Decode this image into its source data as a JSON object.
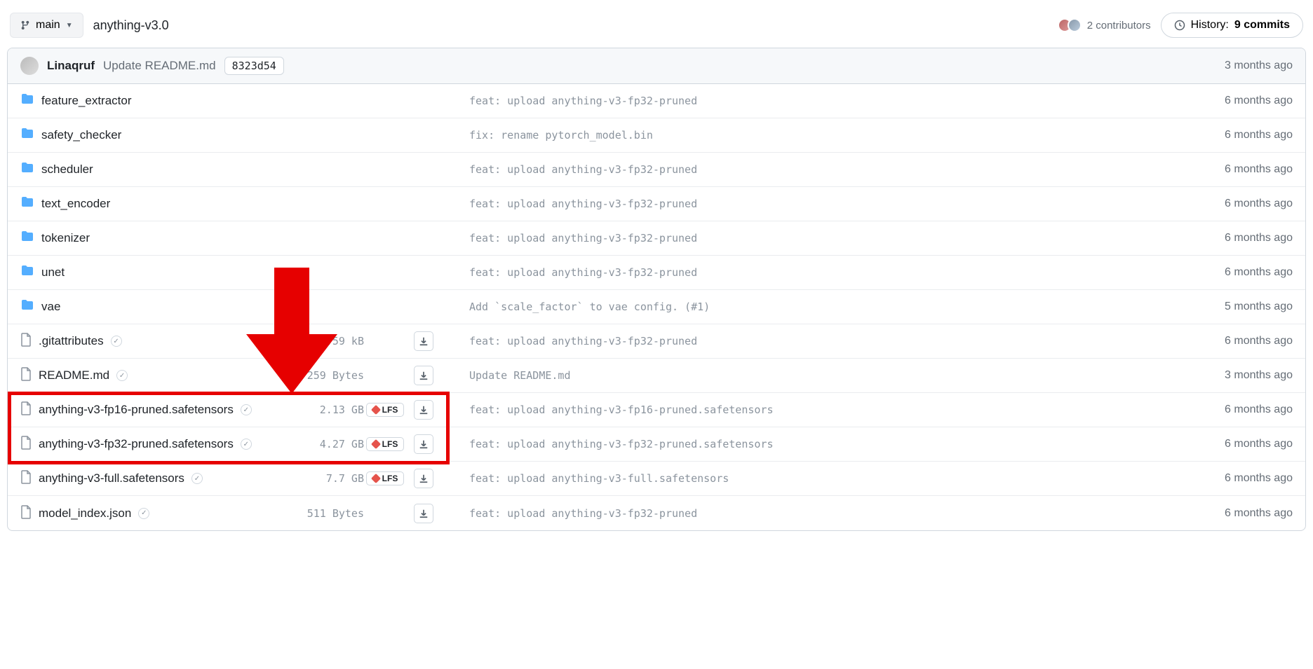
{
  "header": {
    "branch": "main",
    "repo": "anything-v3.0",
    "contributors_count": "2 contributors",
    "history_label": "History:",
    "history_count": "9 commits"
  },
  "commit": {
    "author": "Linaqruf",
    "message": "Update README.md",
    "sha": "8323d54",
    "age": "3 months ago"
  },
  "lfs_label": "LFS",
  "files": [
    {
      "type": "folder",
      "name": "feature_extractor",
      "msg": "feat: upload anything-v3-fp32-pruned",
      "age": "6 months ago"
    },
    {
      "type": "folder",
      "name": "safety_checker",
      "msg": "fix: rename pytorch_model.bin",
      "age": "6 months ago"
    },
    {
      "type": "folder",
      "name": "scheduler",
      "msg": "feat: upload anything-v3-fp32-pruned",
      "age": "6 months ago"
    },
    {
      "type": "folder",
      "name": "text_encoder",
      "msg": "feat: upload anything-v3-fp32-pruned",
      "age": "6 months ago"
    },
    {
      "type": "folder",
      "name": "tokenizer",
      "msg": "feat: upload anything-v3-fp32-pruned",
      "age": "6 months ago"
    },
    {
      "type": "folder",
      "name": "unet",
      "msg": "feat: upload anything-v3-fp32-pruned",
      "age": "6 months ago"
    },
    {
      "type": "folder",
      "name": "vae",
      "msg": "Add `scale_factor` to vae config. (#1)",
      "age": "5 months ago"
    },
    {
      "type": "file",
      "name": ".gitattributes",
      "verified": true,
      "size": "1.59 kB",
      "download": true,
      "msg": "feat: upload anything-v3-fp32-pruned",
      "age": "6 months ago"
    },
    {
      "type": "file",
      "name": "README.md",
      "verified": true,
      "size": "259 Bytes",
      "download": true,
      "msg": "Update README.md",
      "age": "3 months ago"
    },
    {
      "type": "file",
      "name": "anything-v3-fp16-pruned.safetensors",
      "verified": true,
      "size": "2.13 GB",
      "lfs": true,
      "download": true,
      "msg": "feat: upload anything-v3-fp16-pruned.safetensors",
      "age": "6 months ago",
      "highlighted": true
    },
    {
      "type": "file",
      "name": "anything-v3-fp32-pruned.safetensors",
      "verified": true,
      "size": "4.27 GB",
      "lfs": true,
      "download": true,
      "msg": "feat: upload anything-v3-fp32-pruned.safetensors",
      "age": "6 months ago",
      "highlighted": true
    },
    {
      "type": "file",
      "name": "anything-v3-full.safetensors",
      "verified": true,
      "size": "7.7 GB",
      "lfs": true,
      "download": true,
      "msg": "feat: upload anything-v3-full.safetensors",
      "age": "6 months ago"
    },
    {
      "type": "file",
      "name": "model_index.json",
      "verified": true,
      "size": "511 Bytes",
      "download": true,
      "msg": "feat: upload anything-v3-fp32-pruned",
      "age": "6 months ago"
    }
  ],
  "annotation": {
    "arrow_color": "#e60000"
  }
}
